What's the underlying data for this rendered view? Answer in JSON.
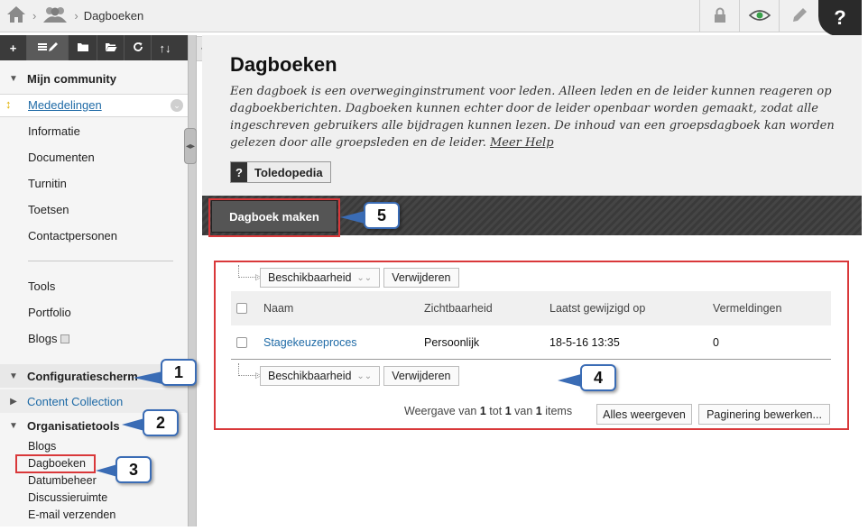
{
  "breadcrumb": {
    "current": "Dagboeken",
    "sep": "›"
  },
  "topbar": {
    "help_label": "?"
  },
  "sidebar": {
    "toolbar": {
      "add": "+",
      "sort": "↑↓"
    },
    "community_title": "Mijn community",
    "community_items": [
      {
        "label": "Mededelingen"
      },
      {
        "label": "Informatie"
      },
      {
        "label": "Documenten"
      },
      {
        "label": "Turnitin"
      },
      {
        "label": "Toetsen"
      },
      {
        "label": "Contactpersonen"
      }
    ],
    "tool_items": [
      {
        "label": "Tools"
      },
      {
        "label": "Portfolio"
      },
      {
        "label": "Blogs"
      }
    ],
    "config_title": "Configuratiescherm",
    "content_collection": "Content Collection",
    "org_title": "Organisatietools",
    "org_items": [
      {
        "label": "Blogs"
      },
      {
        "label": "Dagboeken"
      },
      {
        "label": "Datumbeheer"
      },
      {
        "label": "Discussieruimte"
      },
      {
        "label": "E-mail verzenden"
      }
    ]
  },
  "main": {
    "title": "Dagboeken",
    "description": "Een dagboek is een overweginginstrument voor leden. Alleen leden en de leider kunnen reageren op dagboekberichten. Dagboeken kunnen echter door de leider openbaar worden gemaakt, zodat alle ingeschreven gebruikers alle bijdragen kunnen lezen. De inhoud van een groepsdagboek kan worden gelezen door alle groepsleden en de leider.",
    "more_help": "Meer Help",
    "toledopedia_icon": "?",
    "toledopedia": "Toledopedia",
    "create_button": "Dagboek maken",
    "availability": "Beschikbaarheid",
    "delete": "Verwijderen",
    "columns": {
      "name": "Naam",
      "visibility": "Zichtbaarheid",
      "modified": "Laatst gewijzigd op",
      "mentions": "Vermeldingen"
    },
    "rows": [
      {
        "name": "Stagekeuzeproces",
        "visibility": "Persoonlijk",
        "modified": "18-5-16 13:35",
        "mentions": "0"
      }
    ],
    "pager": {
      "prefix": "Weergave van",
      "from": "1",
      "mid": "tot",
      "to": "1",
      "of": "van",
      "total": "1",
      "suffix": "items"
    },
    "show_all": "Alles weergeven",
    "edit_paging": "Paginering bewerken..."
  },
  "callouts": {
    "c1": "1",
    "c2": "2",
    "c3": "3",
    "c4": "4",
    "c5": "5"
  },
  "colors": {
    "highlight": "#d9383a",
    "callout_border": "#3a6cb5",
    "link": "#1e6aa6"
  }
}
